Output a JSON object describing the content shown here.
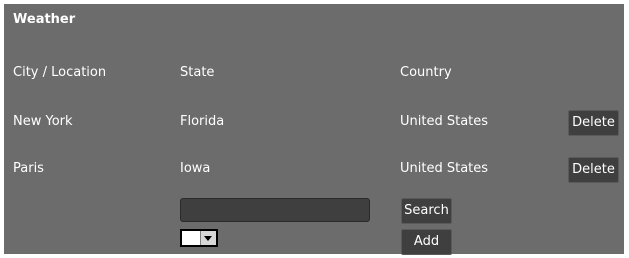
{
  "section": {
    "title": "Weather"
  },
  "table": {
    "headers": {
      "city": "City / Location",
      "state": "State",
      "country": "Country"
    },
    "rows": [
      {
        "city": "New York",
        "state": "Florida",
        "country": "United States",
        "delete_label": "Delete"
      },
      {
        "city": "Paris",
        "state": "Iowa",
        "country": "United States",
        "delete_label": "Delete"
      }
    ]
  },
  "form": {
    "search_value": "",
    "search_label": "Search",
    "add_label": "Add",
    "select_value": ""
  }
}
